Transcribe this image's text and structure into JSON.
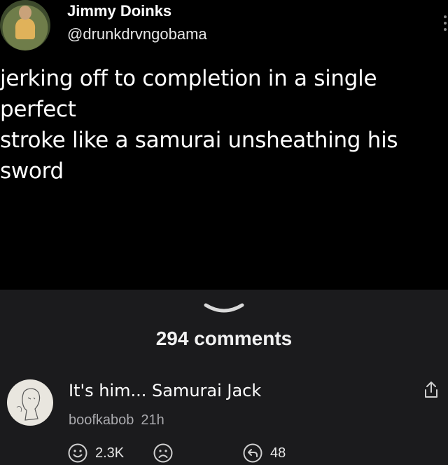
{
  "post": {
    "author_name": "Jimmy Doinks",
    "author_handle": "@drunkdrvngobama",
    "text_lines": [
      "jerking off to completion in a single perfect",
      "stroke like a samurai unsheathing his",
      "sword"
    ]
  },
  "comments_section": {
    "count_label": "294 comments"
  },
  "comment": {
    "text": "It's him... Samurai Jack",
    "username": "boofkabob",
    "time": "21h",
    "like_count": "2.3K",
    "reply_count": "48"
  },
  "icons": {
    "like": "smile-icon",
    "dislike": "frown-icon",
    "reply": "reply-icon",
    "share": "share-icon",
    "collapse": "chevron-down-icon",
    "more": "more-dots-icon"
  }
}
